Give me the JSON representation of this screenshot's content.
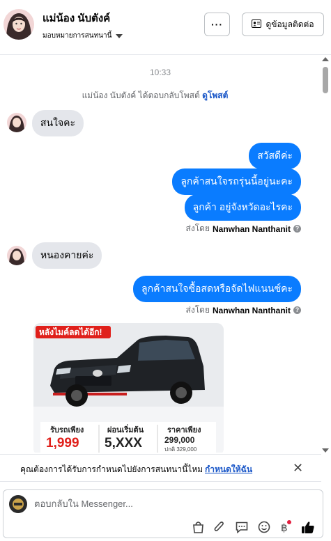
{
  "header": {
    "name": "แม่น้อง นับตังค์",
    "assign_label": "มอบหมายการสนทนานี้",
    "more_label": "···",
    "contact_label": "ดูข้อมูลติดต่อ"
  },
  "chat": {
    "time": "10:33",
    "system_message": "แม่น้อง นับตังค์ ได้ตอบกลับโพสต์",
    "system_link": "ดูโพสต์",
    "messages": [
      {
        "from": "customer",
        "text": "สนใจคะ"
      },
      {
        "from": "page",
        "text": "สวัสดีค่ะ"
      },
      {
        "from": "page",
        "text": "ลูกค้าสนใจรถรุ่นนี้อยู่นะคะ"
      },
      {
        "from": "page",
        "text": "ลูกค้า อยู่จังหวัดอะไรคะ"
      },
      {
        "from": "customer",
        "text": "หนองคายค่ะ"
      },
      {
        "from": "page",
        "text": "ลูกค้าสนใจซื้อสดหรือจัดไฟแนนซ์คะ"
      }
    ],
    "sent_by_prefix": "ส่งโดย",
    "sent_by_name": "Nanwhan Nanthanit",
    "ad": {
      "headline": "หลังไมค์ลดได้อีก!",
      "col1_title": "รับรถเพียง",
      "col1_value": "1,999",
      "col2_title": "ผ่อนเริ่มต้น",
      "col2_value": "5,XXX",
      "col3_title": "ราคาเพียง",
      "col3_value": "299,000",
      "col3_sub": "ปกติ 329,000"
    }
  },
  "notify": {
    "text": "คุณต้องการได้รับการกำหนดไปยังการสนทนานี้ไหม",
    "link": "กำหนดให้ฉัน",
    "close": "✕"
  },
  "composer": {
    "placeholder": "ตอบกลับใน Messenger..."
  },
  "colors": {
    "outgoing_bubble": "#0a7cff",
    "incoming_bubble": "#e4e6eb",
    "link": "#1a57c8",
    "ad_red": "#e0201b"
  }
}
